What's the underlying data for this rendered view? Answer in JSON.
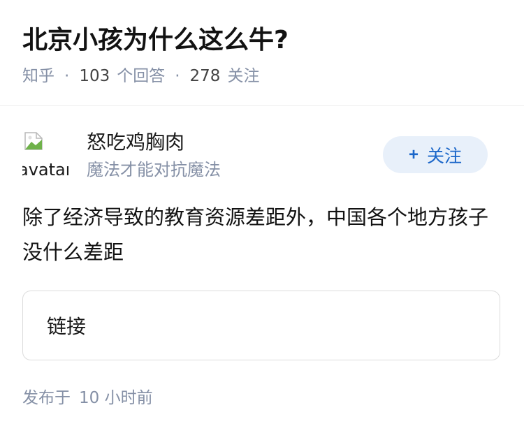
{
  "question": {
    "title": "北京小孩为什么这么牛?",
    "source": "知乎",
    "answer_count": "103",
    "answer_label": "个回答",
    "follower_count": "278",
    "follower_label": "关注"
  },
  "author": {
    "avatar_alt": "avatar",
    "name": "怒吃鸡胸肉",
    "bio": "魔法才能对抗魔法",
    "follow_label": "关注",
    "follow_icon": "plus-icon"
  },
  "answer": {
    "text": "除了经济导致的教育资源差距外，中国各个地方孩子没什么差距",
    "link_label": "链接"
  },
  "footer": {
    "published_prefix": "发布于",
    "published_time": "10 小时前"
  },
  "colors": {
    "muted": "#8590a6",
    "accent": "#1a66c9",
    "follow_bg": "#e8f0fa"
  }
}
